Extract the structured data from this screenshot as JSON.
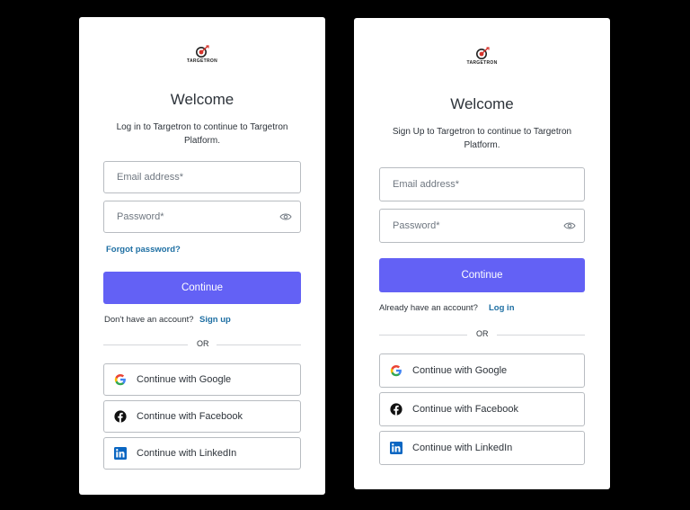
{
  "brand": {
    "name": "TARGETRON"
  },
  "login": {
    "title": "Welcome",
    "subtitle_line1": "Log in to Targetron to continue to Targetron",
    "subtitle_line2": "Platform.",
    "email_placeholder": "Email address*",
    "password_placeholder": "Password*",
    "forgot_label": "Forgot password?",
    "continue_label": "Continue",
    "alt_prompt": "Don't have an account?",
    "alt_link": "Sign up",
    "divider_label": "OR",
    "google_label": "Continue with Google",
    "facebook_label": "Continue with Facebook",
    "linkedin_label": "Continue with LinkedIn"
  },
  "signup": {
    "title": "Welcome",
    "subtitle_line1": "Sign Up to Targetron to continue to Targetron",
    "subtitle_line2": "Platform.",
    "email_placeholder": "Email address*",
    "password_placeholder": "Password*",
    "continue_label": "Continue",
    "alt_prompt": "Already have an account?",
    "alt_link": "Log in",
    "divider_label": "OR",
    "google_label": "Continue with Google",
    "facebook_label": "Continue with Facebook",
    "linkedin_label": "Continue with LinkedIn"
  },
  "colors": {
    "primary": "#6361f5",
    "link": "#1e6fa3",
    "logo_red": "#d6332b",
    "facebook": "#111111",
    "linkedin": "#0a66c2"
  },
  "icons": [
    "brand-logo",
    "eye-icon",
    "google-icon",
    "facebook-icon",
    "linkedin-icon"
  ]
}
